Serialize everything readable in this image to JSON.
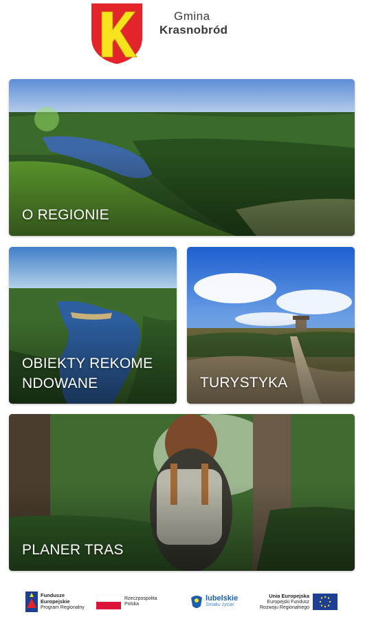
{
  "header": {
    "crest_icon": "coat-of-arms-letter-k",
    "brand_line1": "Gmina",
    "brand_line2": "Krasnobród",
    "crest_colors": {
      "shield": "#e3242b",
      "letter": "#f6e21d"
    }
  },
  "tiles": [
    {
      "id": "region",
      "label": "O REGIONIE"
    },
    {
      "id": "objects",
      "label": "OBIEKTY REKOME\nNDOWANE"
    },
    {
      "id": "tourism",
      "label": "TURYSTYKA"
    },
    {
      "id": "planner",
      "label": "PLANER TRAS"
    }
  ],
  "footer": {
    "logos": [
      {
        "name": "fundusze-europejskie",
        "line1": "Fundusze",
        "line2": "Europejskie",
        "line3": "Program Regionalny"
      },
      {
        "name": "rzeczpospolita-polska",
        "line1": "Rzeczpospolita",
        "line2": "Polska"
      },
      {
        "name": "lubelskie",
        "line1": "lubelskie",
        "line2": "Smaku życia!"
      },
      {
        "name": "unia-europejska",
        "line1": "Unia Europejska",
        "line2": "Europejski Fundusz",
        "line3": "Rozwoju Regionalnego"
      }
    ]
  }
}
